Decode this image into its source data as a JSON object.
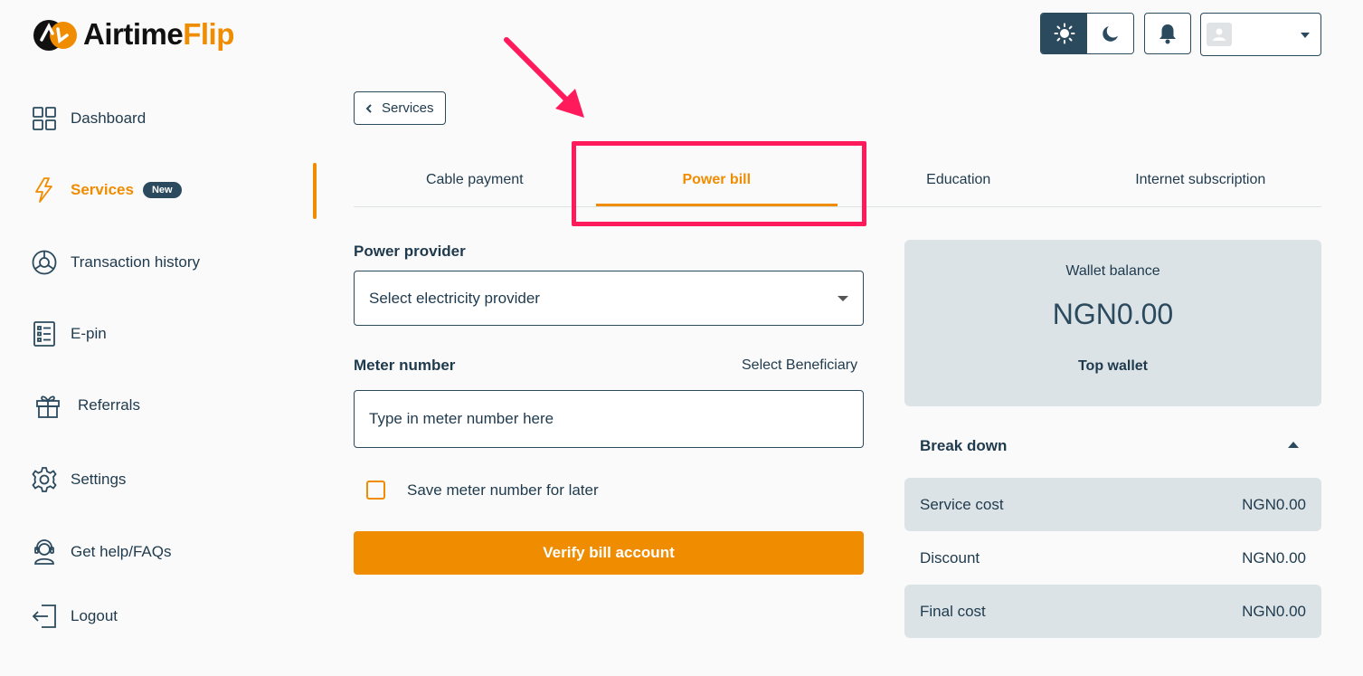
{
  "brand": {
    "name_part1": "Airtime",
    "name_part2": "Flip",
    "accent_color": "#f08c00",
    "primary_color": "#2b4a5e"
  },
  "header": {
    "theme_light_icon": "sun-icon",
    "theme_dark_icon": "moon-icon",
    "notifications_icon": "bell-icon",
    "user_menu_icon": "user-avatar-icon"
  },
  "sidebar": {
    "items": [
      {
        "label": "Dashboard",
        "icon": "grid-icon"
      },
      {
        "label": "Services",
        "icon": "lightning-icon",
        "badge": "New",
        "active": true
      },
      {
        "label": "Transaction history",
        "icon": "chart-pie-icon"
      },
      {
        "label": "E-pin",
        "icon": "list-icon"
      },
      {
        "label": "Referrals",
        "icon": "gift-icon"
      },
      {
        "label": "Settings",
        "icon": "gear-icon"
      },
      {
        "label": "Get help/FAQs",
        "icon": "support-agent-icon"
      },
      {
        "label": "Logout",
        "icon": "logout-icon"
      }
    ]
  },
  "back_button": {
    "label": "Services"
  },
  "tabs": [
    {
      "label": "Cable payment"
    },
    {
      "label": "Power bill",
      "active": true
    },
    {
      "label": "Education"
    },
    {
      "label": "Internet subscription"
    }
  ],
  "form": {
    "provider_label": "Power provider",
    "provider_placeholder": "Select electricity provider",
    "meter_label": "Meter number",
    "select_beneficiary": "Select Beneficiary",
    "meter_placeholder": "Type in meter number here",
    "meter_value": "",
    "save_checkbox_label": "Save meter number for later",
    "save_checked": false,
    "verify_button": "Verify bill account"
  },
  "wallet": {
    "title": "Wallet balance",
    "amount": "NGN0.00",
    "top_label": "Top wallet"
  },
  "breakdown": {
    "title": "Break down",
    "rows": [
      {
        "label": "Service cost",
        "value": "NGN0.00"
      },
      {
        "label": "Discount",
        "value": "NGN0.00"
      },
      {
        "label": "Final cost",
        "value": "NGN0.00"
      }
    ]
  },
  "annotation": {
    "highlight_color": "#ff1a5c"
  }
}
